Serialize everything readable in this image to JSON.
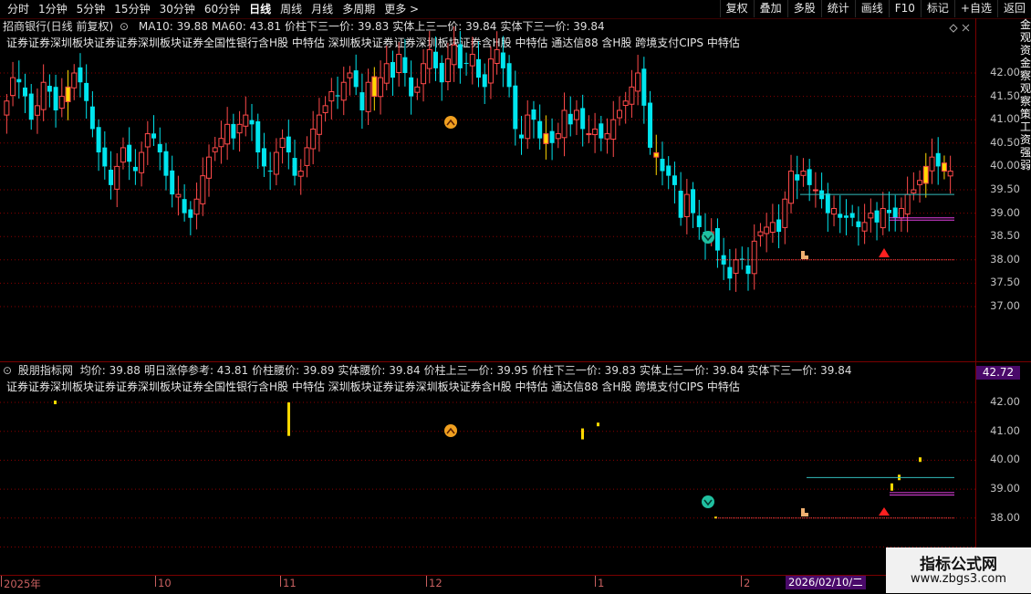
{
  "toolbar": {
    "tabs": [
      "分时",
      "1分钟",
      "5分钟",
      "15分钟",
      "30分钟",
      "60分钟",
      "日线",
      "周线",
      "月线",
      "多周期",
      "更多 >"
    ],
    "active_tab": "日线",
    "right_buttons": [
      "复权",
      "叠加",
      "多股",
      "统计",
      "画线",
      "F10",
      "标记",
      "+自选",
      "返回"
    ]
  },
  "main_legend": {
    "title": "招商银行(日线 前复权)",
    "items": [
      "MA10: 39.88",
      "MA60: 43.81",
      "价柱下三一价: 39.83",
      "实体上三一价: 39.84",
      "实体下三一价: 39.84"
    ]
  },
  "concepts_text": "证券证券深圳板块证券证券深圳板块证券全国性银行含H股 中特估 深圳板块证券证券深圳板块证券含H股 中特估 通达信88 含H股 跨境支付CIPS 中特估",
  "price_axis": [
    "42.00",
    "41.50",
    "41.00",
    "40.50",
    "40.00",
    "39.50",
    "39.00",
    "38.50",
    "38.00",
    "37.50",
    "37.00"
  ],
  "indicator_legend": {
    "title": "股朋指标网",
    "items": [
      "均价: 39.88",
      "明日涨停参考: 43.81",
      "价柱腰价: 39.89",
      "实体腰价: 39.84",
      "价柱上三一价: 39.95",
      "价柱下三一价: 39.83",
      "实体上三一价: 39.84",
      "实体下三一价: 39.84"
    ]
  },
  "indicator_axis": [
    "42.00",
    "41.00",
    "40.00",
    "39.00",
    "38.00"
  ],
  "indicator_badge": "42.72",
  "right_strip_text": "金观资金察观察策工资强弱",
  "dates": {
    "items": [
      {
        "label": "2025年"
      },
      {
        "label": "10"
      },
      {
        "label": "11"
      },
      {
        "label": "12"
      },
      {
        "label": "1"
      },
      {
        "label": "2"
      }
    ],
    "cursor_date": "2026/02/10/二"
  },
  "watermark": {
    "line1": "指标公式网",
    "line2": "www.zbgs3.com"
  },
  "colors": {
    "up": "#ff4a4a",
    "down": "#00e5ee",
    "highlight": "#ffd800",
    "grid": "#8a0000",
    "teal": "#33bbbb",
    "magenta": "#e040e0"
  }
}
